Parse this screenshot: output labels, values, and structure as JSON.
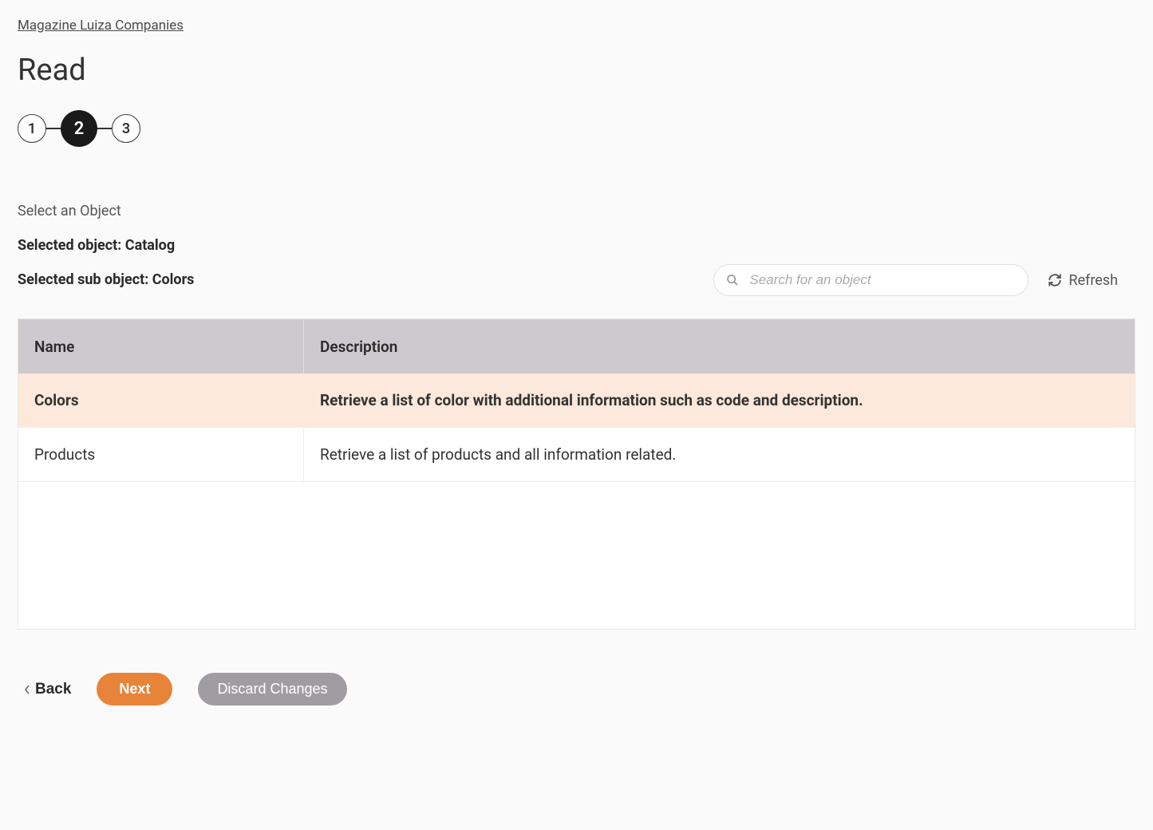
{
  "breadcrumb": {
    "label": "Magazine Luiza Companies"
  },
  "page_title": "Read",
  "stepper": {
    "steps": [
      "1",
      "2",
      "3"
    ],
    "active_index": 1
  },
  "section": {
    "label": "Select an Object",
    "selected_object_label": "Selected object: Catalog",
    "selected_sub_object_label": "Selected sub object: Colors"
  },
  "search": {
    "placeholder": "Search for an object"
  },
  "refresh_label": "Refresh",
  "table": {
    "headers": {
      "name": "Name",
      "description": "Description"
    },
    "rows": [
      {
        "name": "Colors",
        "description": "Retrieve a list of color with additional information such as code and description.",
        "selected": true
      },
      {
        "name": "Products",
        "description": "Retrieve a list of products and all information related.",
        "selected": false
      }
    ]
  },
  "footer": {
    "back_label": "Back",
    "next_label": "Next",
    "discard_label": "Discard Changes"
  }
}
